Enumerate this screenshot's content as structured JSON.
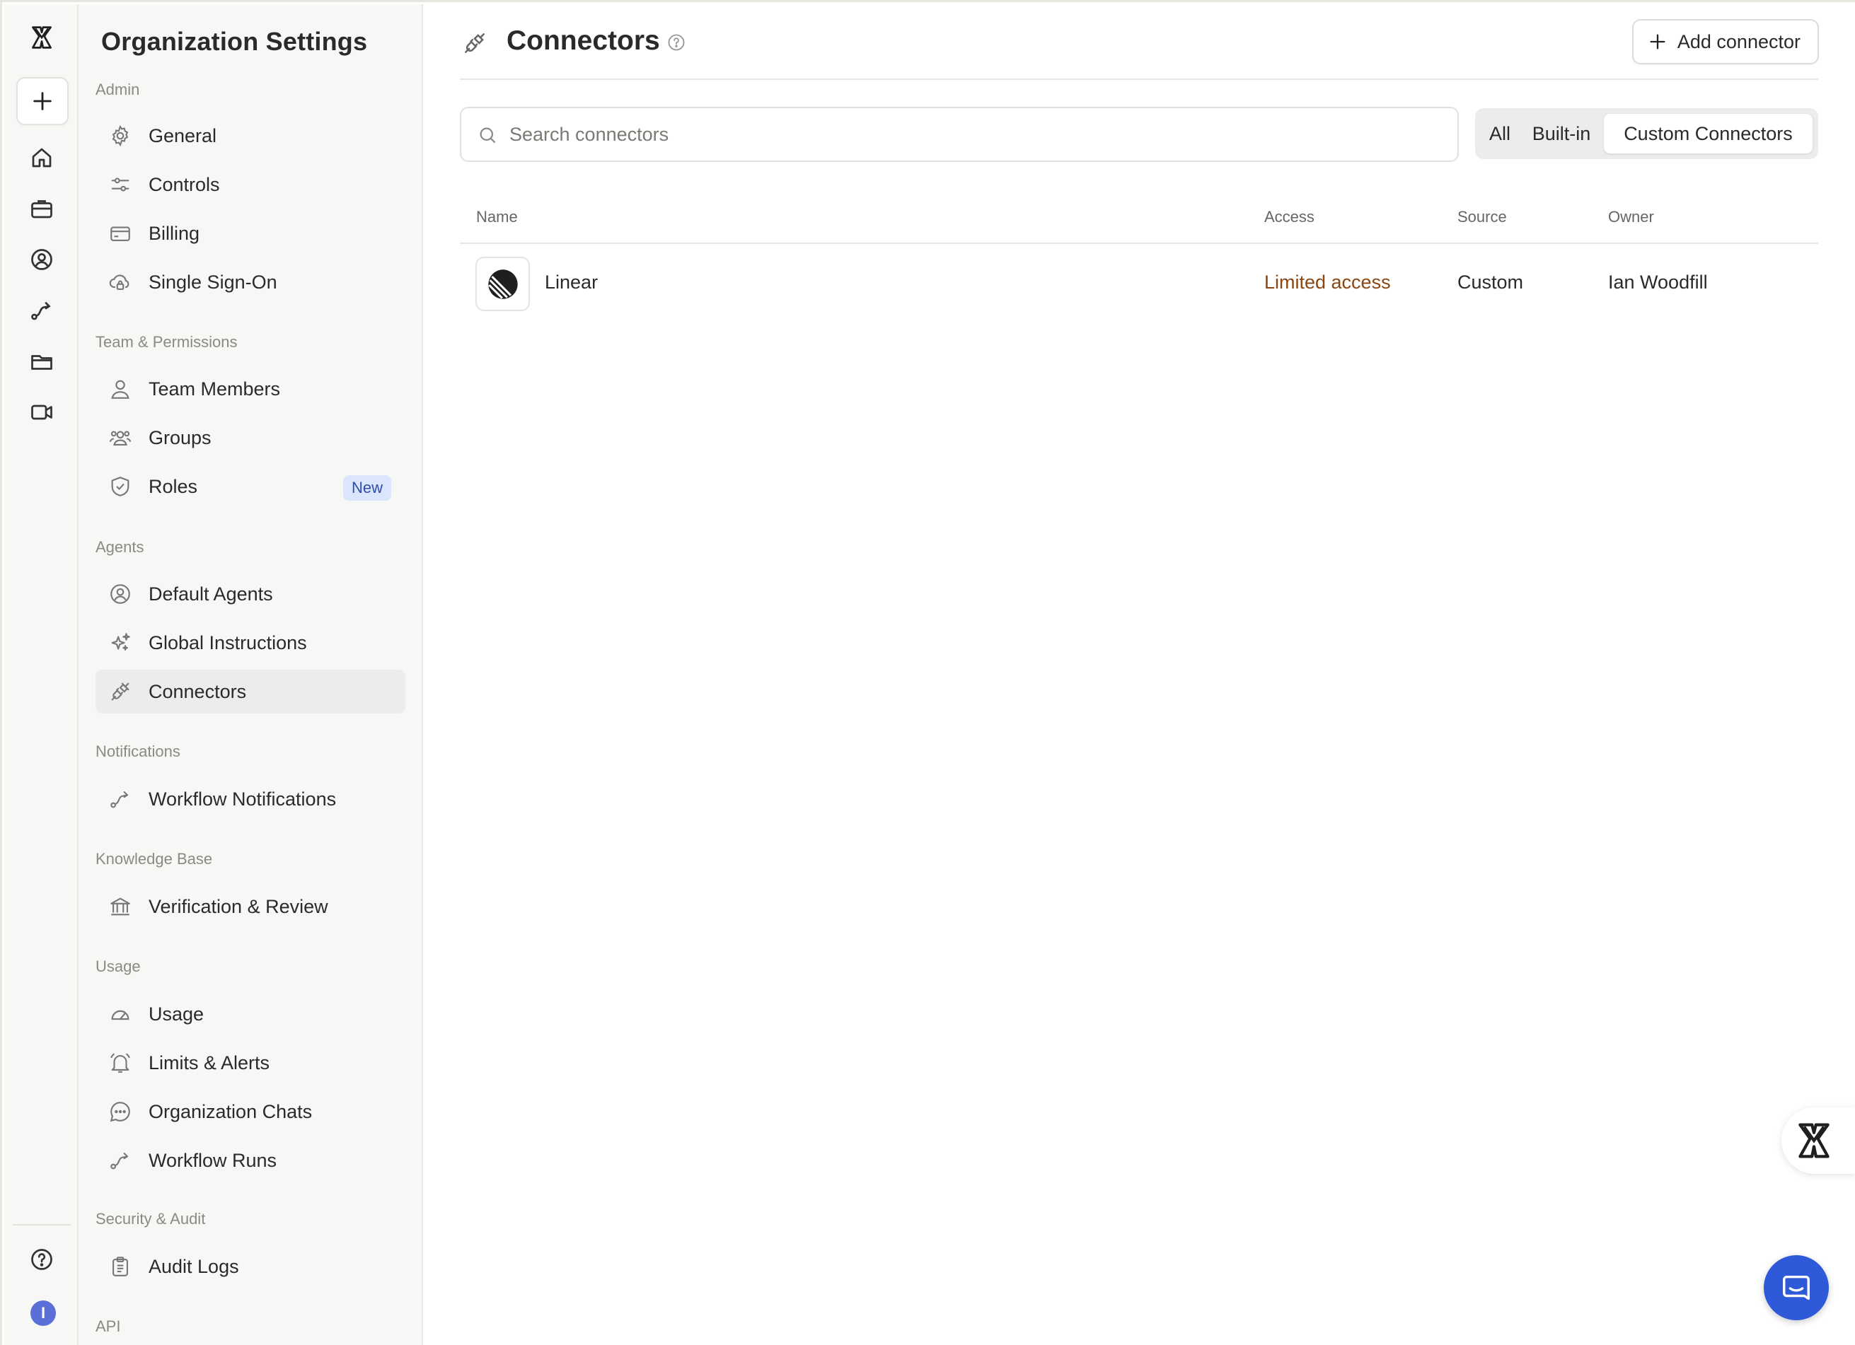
{
  "rail": {
    "items": [
      "new-chat",
      "home",
      "briefcase",
      "agents",
      "workflows",
      "folder",
      "video"
    ],
    "avatar_initial": "I"
  },
  "sidebar": {
    "title": "Organization Settings",
    "sections": [
      {
        "label": "Admin",
        "items": [
          {
            "label": "General",
            "icon": "gear-icon"
          },
          {
            "label": "Controls",
            "icon": "sliders-icon"
          },
          {
            "label": "Billing",
            "icon": "credit-card-icon"
          },
          {
            "label": "Single Sign-On",
            "icon": "cloud-lock-icon"
          }
        ]
      },
      {
        "label": "Team & Permissions",
        "items": [
          {
            "label": "Team Members",
            "icon": "user-icon"
          },
          {
            "label": "Groups",
            "icon": "group-icon"
          },
          {
            "label": "Roles",
            "icon": "shield-check-icon",
            "badge": "New"
          }
        ]
      },
      {
        "label": "Agents",
        "items": [
          {
            "label": "Default Agents",
            "icon": "user-circle-icon"
          },
          {
            "label": "Global Instructions",
            "icon": "sparkles-icon"
          },
          {
            "label": "Connectors",
            "icon": "plug-icon",
            "active": true
          }
        ]
      },
      {
        "label": "Notifications",
        "items": [
          {
            "label": "Workflow Notifications",
            "icon": "route-icon"
          }
        ]
      },
      {
        "label": "Knowledge Base",
        "items": [
          {
            "label": "Verification & Review",
            "icon": "bank-icon"
          }
        ]
      },
      {
        "label": "Usage",
        "items": [
          {
            "label": "Usage",
            "icon": "gauge-icon"
          },
          {
            "label": "Limits & Alerts",
            "icon": "bell-icon"
          },
          {
            "label": "Organization Chats",
            "icon": "chat-icon"
          },
          {
            "label": "Workflow Runs",
            "icon": "route-icon"
          }
        ]
      },
      {
        "label": "Security & Audit",
        "items": [
          {
            "label": "Audit Logs",
            "icon": "clipboard-icon"
          }
        ]
      },
      {
        "label": "API",
        "items": []
      }
    ]
  },
  "main": {
    "title": "Connectors",
    "add_button_label": "Add connector",
    "search_placeholder": "Search connectors",
    "filters": [
      {
        "label": "All",
        "active": false
      },
      {
        "label": "Built-in",
        "active": false
      },
      {
        "label": "Custom Connectors",
        "active": true
      }
    ],
    "table": {
      "columns": [
        "Name",
        "Access",
        "Source",
        "Owner"
      ],
      "rows": [
        {
          "name": "Linear",
          "access": "Limited access",
          "source": "Custom",
          "owner": "Ian Woodfill",
          "logo": "linear-logo-icon"
        }
      ]
    }
  },
  "colors": {
    "accent": "#2e59d9",
    "access_limited": "#8b4513",
    "badge_bg": "#dbe5fb",
    "sidebar_bg": "#f7f7f5"
  }
}
